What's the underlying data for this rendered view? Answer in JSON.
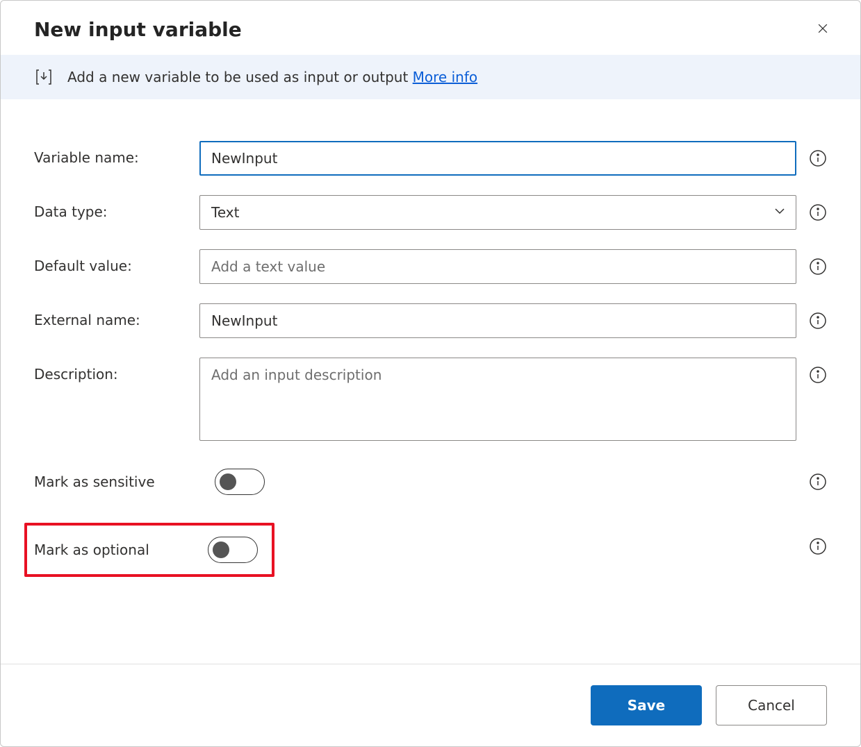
{
  "dialog": {
    "title": "New input variable"
  },
  "banner": {
    "text": "Add a new variable to be used as input or output ",
    "link_text": "More info"
  },
  "form": {
    "variable_name": {
      "label": "Variable name:",
      "value": "NewInput"
    },
    "data_type": {
      "label": "Data type:",
      "value": "Text"
    },
    "default_value": {
      "label": "Default value:",
      "value": "",
      "placeholder": "Add a text value"
    },
    "external_name": {
      "label": "External name:",
      "value": "NewInput"
    },
    "description": {
      "label": "Description:",
      "value": "",
      "placeholder": "Add an input description"
    },
    "mark_sensitive": {
      "label": "Mark as sensitive",
      "on": false
    },
    "mark_optional": {
      "label": "Mark as optional",
      "on": false
    }
  },
  "footer": {
    "save": "Save",
    "cancel": "Cancel"
  }
}
